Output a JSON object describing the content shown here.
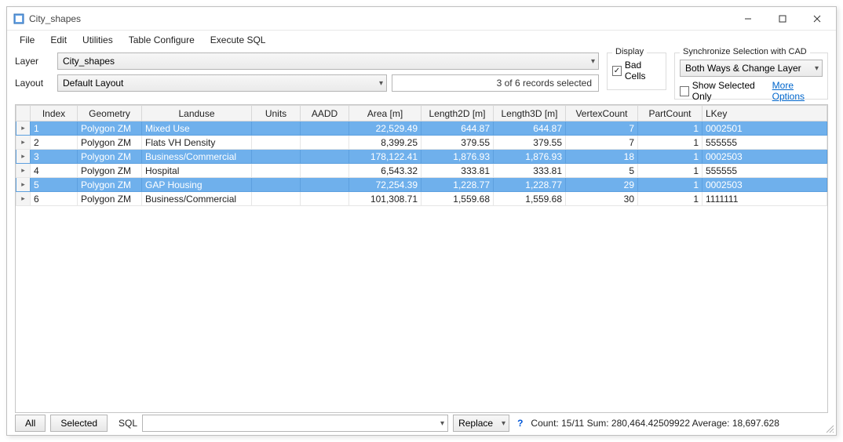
{
  "window": {
    "title": "City_shapes"
  },
  "menu": {
    "file": "File",
    "edit": "Edit",
    "utilities": "Utilities",
    "table_configure": "Table Configure",
    "execute_sql": "Execute SQL"
  },
  "controls": {
    "layer_label": "Layer",
    "layer_value": "City_shapes",
    "layout_label": "Layout",
    "layout_value": "Default Layout",
    "selection_status": "3 of 6 records selected"
  },
  "display_group": {
    "legend": "Display",
    "bad_cells_label": "Bad Cells",
    "bad_cells_checked": true
  },
  "sync_group": {
    "legend": "Synchronize Selection with CAD",
    "mode_value": "Both Ways & Change Layer",
    "show_selected_label": "Show Selected Only",
    "show_selected_checked": false,
    "more_options": "More Options"
  },
  "grid": {
    "columns": [
      "",
      "Index",
      "Geometry",
      "Landuse",
      "Units",
      "AADD",
      "Area [m]",
      "Length2D [m]",
      "Length3D [m]",
      "VertexCount",
      "PartCount",
      "LKey"
    ],
    "rows": [
      {
        "selected": true,
        "index": "1",
        "geometry": "Polygon ZM",
        "landuse": "Mixed Use",
        "units": "",
        "aadd": "",
        "area": "22,529.49",
        "len2d": "644.87",
        "len3d": "644.87",
        "vcount": "7",
        "pcount": "1",
        "lkey": "0002501"
      },
      {
        "selected": false,
        "index": "2",
        "geometry": "Polygon ZM",
        "landuse": "Flats VH Density",
        "units": "",
        "aadd": "",
        "area": "8,399.25",
        "len2d": "379.55",
        "len3d": "379.55",
        "vcount": "7",
        "pcount": "1",
        "lkey": "555555"
      },
      {
        "selected": true,
        "index": "3",
        "geometry": "Polygon ZM",
        "landuse": "Business/Commercial",
        "units": "",
        "aadd": "",
        "area": "178,122.41",
        "len2d": "1,876.93",
        "len3d": "1,876.93",
        "vcount": "18",
        "pcount": "1",
        "lkey": "0002503"
      },
      {
        "selected": false,
        "index": "4",
        "geometry": "Polygon ZM",
        "landuse": "Hospital",
        "units": "",
        "aadd": "",
        "area": "6,543.32",
        "len2d": "333.81",
        "len3d": "333.81",
        "vcount": "5",
        "pcount": "1",
        "lkey": "555555"
      },
      {
        "selected": true,
        "index": "5",
        "geometry": "Polygon ZM",
        "landuse": "GAP Housing",
        "units": "",
        "aadd": "",
        "area": "72,254.39",
        "len2d": "1,228.77",
        "len3d": "1,228.77",
        "vcount": "29",
        "pcount": "1",
        "lkey": "0002503"
      },
      {
        "selected": false,
        "index": "6",
        "geometry": "Polygon ZM",
        "landuse": "Business/Commercial",
        "units": "",
        "aadd": "",
        "area": "101,308.71",
        "len2d": "1,559.68",
        "len3d": "1,559.68",
        "vcount": "30",
        "pcount": "1",
        "lkey": "1111111"
      }
    ]
  },
  "footer": {
    "all": "All",
    "selected": "Selected",
    "sql_label": "SQL",
    "replace": "Replace",
    "stats": "Count: 15/11   Sum: 280,464.42509922   Average: 18,697.628"
  }
}
